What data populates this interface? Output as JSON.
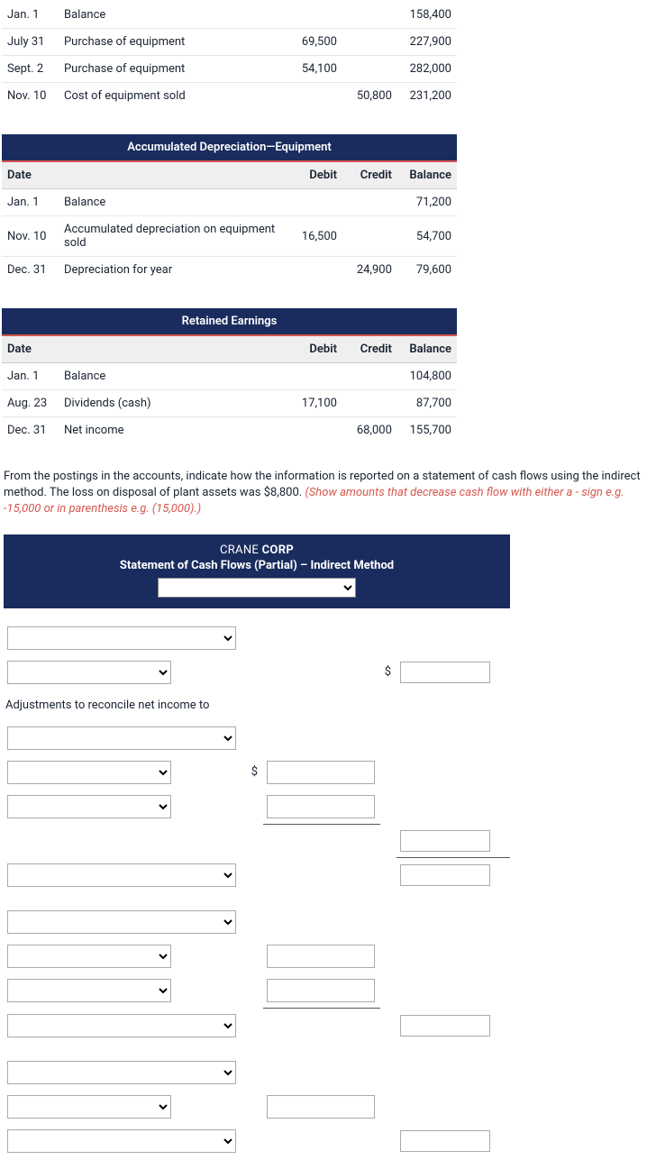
{
  "tables": {
    "equipment": {
      "rows": [
        {
          "date": "Jan. 1",
          "desc": "Balance",
          "debit": "",
          "credit": "",
          "bal": "158,400"
        },
        {
          "date": "July 31",
          "desc": "Purchase of equipment",
          "debit": "69,500",
          "credit": "",
          "bal": "227,900"
        },
        {
          "date": "Sept. 2",
          "desc": "Purchase of equipment",
          "debit": "54,100",
          "credit": "",
          "bal": "282,000"
        },
        {
          "date": "Nov. 10",
          "desc": "Cost of equipment sold",
          "debit": "",
          "credit": "50,800",
          "bal": "231,200"
        }
      ]
    },
    "accdep": {
      "title": "Accumulated Depreciation—Equipment",
      "head": {
        "date": "Date",
        "debit": "Debit",
        "credit": "Credit",
        "bal": "Balance"
      },
      "rows": [
        {
          "date": "Jan. 1",
          "desc": "Balance",
          "debit": "",
          "credit": "",
          "bal": "71,200"
        },
        {
          "date": "Nov. 10",
          "desc": "Accumulated depreciation on equipment sold",
          "debit": "16,500",
          "credit": "",
          "bal": "54,700"
        },
        {
          "date": "Dec. 31",
          "desc": "Depreciation for year",
          "debit": "",
          "credit": "24,900",
          "bal": "79,600"
        }
      ]
    },
    "re": {
      "title": "Retained Earnings",
      "head": {
        "date": "Date",
        "debit": "Debit",
        "credit": "Credit",
        "bal": "Balance"
      },
      "rows": [
        {
          "date": "Jan. 1",
          "desc": "Balance",
          "debit": "",
          "credit": "",
          "bal": "104,800"
        },
        {
          "date": "Aug. 23",
          "desc": "Dividends (cash)",
          "debit": "17,100",
          "credit": "",
          "bal": "87,700"
        },
        {
          "date": "Dec. 31",
          "desc": "Net income",
          "debit": "",
          "credit": "68,000",
          "bal": "155,700"
        }
      ]
    }
  },
  "instruction": {
    "p1": "From the postings in the accounts, indicate how the information is reported on a statement of cash flows using the indirect method. The loss on disposal of plant assets was $8,800. ",
    "red": "(Show amounts that decrease cash flow with either a - sign e.g. -15,000 or in parenthesis e.g. (15,000).)"
  },
  "formHeader": {
    "l1a": "CRANE ",
    "l1b": "CORP",
    "l2": "Statement of Cash Flows (Partial) – Indirect Method"
  },
  "labels": {
    "adj": "Adjustments to reconcile net income to",
    "dollar": "$"
  }
}
